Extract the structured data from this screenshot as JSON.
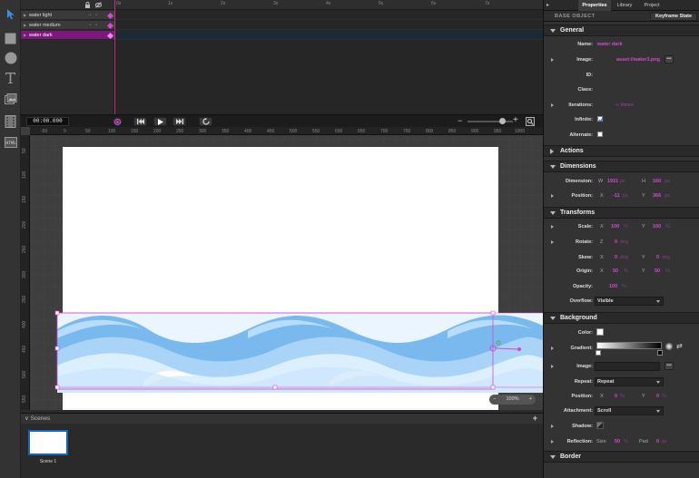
{
  "timeline": {
    "layers": [
      {
        "label": "water light",
        "selected": false
      },
      {
        "label": "water medium",
        "selected": false
      },
      {
        "label": "water dark",
        "selected": true
      }
    ],
    "ruler_ticks": [
      "0s",
      "1s",
      "2s",
      "3s",
      "4s",
      "5s",
      "6s",
      "7s"
    ],
    "timecode": "00:00.000"
  },
  "stage": {
    "h_ruler": [
      "-50",
      "0",
      "50",
      "100",
      "150",
      "200",
      "250",
      "300",
      "350",
      "400",
      "450",
      "500",
      "550",
      "600",
      "650",
      "700",
      "750",
      "800",
      "850",
      "900",
      "950",
      "1000"
    ],
    "v_ruler": [
      "50",
      "100",
      "150",
      "200",
      "250",
      "300",
      "350",
      "400",
      "450",
      "500",
      "550"
    ],
    "zoom_label": "100%"
  },
  "scenes": {
    "header": "Scenes",
    "items": [
      {
        "label": "Scene 1"
      }
    ]
  },
  "panel": {
    "tabs": [
      "Properties",
      "Library",
      "Project"
    ],
    "subheader": "BASE OBJECT",
    "keyframe_label": "Keyframe State",
    "general": {
      "title": "General",
      "name_label": "Name:",
      "name_value": "water dark",
      "image_label": "Image:",
      "image_value": "asset://water3.png",
      "id_label": "ID:",
      "class_label": "Class:",
      "iterations_label": "Iterations:",
      "iterations_value": "∞ times",
      "infinite_label": "Infinite:",
      "alternate_label": "Alternate:"
    },
    "actions": {
      "title": "Actions"
    },
    "dimensions": {
      "title": "Dimensions",
      "dimension_label": "Dimension:",
      "w_axis": "W",
      "w_value": "1921",
      "w_unit": "px",
      "h_axis": "H",
      "h_value": "160",
      "h_unit": "px",
      "position_label": "Position:",
      "x_axis": "X",
      "x_value": "-11",
      "x_unit": "px",
      "y_axis": "Y",
      "y_value": "366",
      "y_unit": "px"
    },
    "transforms": {
      "title": "Transforms",
      "scale_label": "Scale:",
      "scale_x_axis": "X",
      "scale_x": "100",
      "scale_x_unit": "%",
      "scale_y_axis": "Y",
      "scale_y": "100",
      "scale_y_unit": "%",
      "rotate_label": "Rotate:",
      "rotate_axis": "Z",
      "rotate_value": "0",
      "rotate_unit": "deg",
      "skew_label": "Skew:",
      "skew_x_axis": "X",
      "skew_x": "0",
      "skew_x_unit": "deg",
      "skew_y_axis": "Y",
      "skew_y": "0",
      "skew_y_unit": "deg",
      "origin_label": "Origin:",
      "origin_x_axis": "X",
      "origin_x": "50",
      "origin_x_unit": "%",
      "origin_y_axis": "Y",
      "origin_y": "50",
      "origin_y_unit": "%",
      "opacity_label": "Opacity:",
      "opacity_value": "100",
      "opacity_unit": "%",
      "overflow_label": "Overflow:",
      "overflow_value": "Visible"
    },
    "background": {
      "title": "Background",
      "color_label": "Color:",
      "gradient_label": "Gradient:",
      "image_label": "Image:",
      "repeat_label": "Repeat:",
      "repeat_value": "Repeat",
      "position_label": "Position:",
      "pos_x_axis": "X",
      "pos_x": "0",
      "pos_x_unit": "%",
      "pos_y_axis": "Y",
      "pos_y": "0",
      "pos_y_unit": "%",
      "attachment_label": "Attachment:",
      "attachment_value": "Scroll",
      "shadow_label": "Shadow:",
      "reflection_label": "Reflection:",
      "refl_size_axis": "Size",
      "refl_size": "50",
      "refl_size_unit": "%",
      "refl_pad_axis": "Pad",
      "refl_pad": "0",
      "refl_pad_unit": "px"
    },
    "border": {
      "title": "Border"
    }
  },
  "colors": {
    "accent": "#d24ad2",
    "selected_layer": "#7c177c",
    "playhead": "#c62d7a",
    "wave_light": "#dcefff",
    "wave_medium": "#a9d4f7",
    "wave_dark": "#7ab9ee"
  },
  "icons": {
    "select": "arrow-pointer-icon",
    "rect": "rectangle-icon",
    "ellipse": "ellipse-icon",
    "text": "text-icon",
    "image": "image-icon",
    "video": "video-icon",
    "html": "html-icon"
  }
}
